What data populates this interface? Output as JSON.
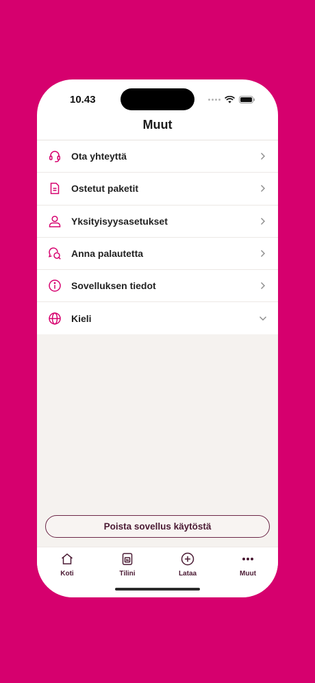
{
  "status": {
    "time": "10.43"
  },
  "header": {
    "title": "Muut"
  },
  "menu": [
    {
      "label": "Ota yhteyttä",
      "icon": "headset-icon",
      "action": "chevron-right-icon"
    },
    {
      "label": "Ostetut paketit",
      "icon": "document-icon",
      "action": "chevron-right-icon"
    },
    {
      "label": "Yksityisyysasetukset",
      "icon": "person-icon",
      "action": "chevron-right-icon"
    },
    {
      "label": "Anna palautetta",
      "icon": "feedback-icon",
      "action": "chevron-right-icon"
    },
    {
      "label": "Sovelluksen tiedot",
      "icon": "info-icon",
      "action": "chevron-right-icon"
    },
    {
      "label": "Kieli",
      "icon": "globe-icon",
      "action": "chevron-down-icon"
    }
  ],
  "deactivate_button": {
    "label": "Poista sovellus käytöstä"
  },
  "tabs": [
    {
      "label": "Koti",
      "icon": "home-icon"
    },
    {
      "label": "Tilini",
      "icon": "sim-card-icon"
    },
    {
      "label": "Lataa",
      "icon": "plus-circle-icon"
    },
    {
      "label": "Muut",
      "icon": "more-dots-icon"
    }
  ],
  "colors": {
    "brand": "#d6006e",
    "accent_text": "#4a1a33",
    "content_bg": "#f5f2ef"
  }
}
